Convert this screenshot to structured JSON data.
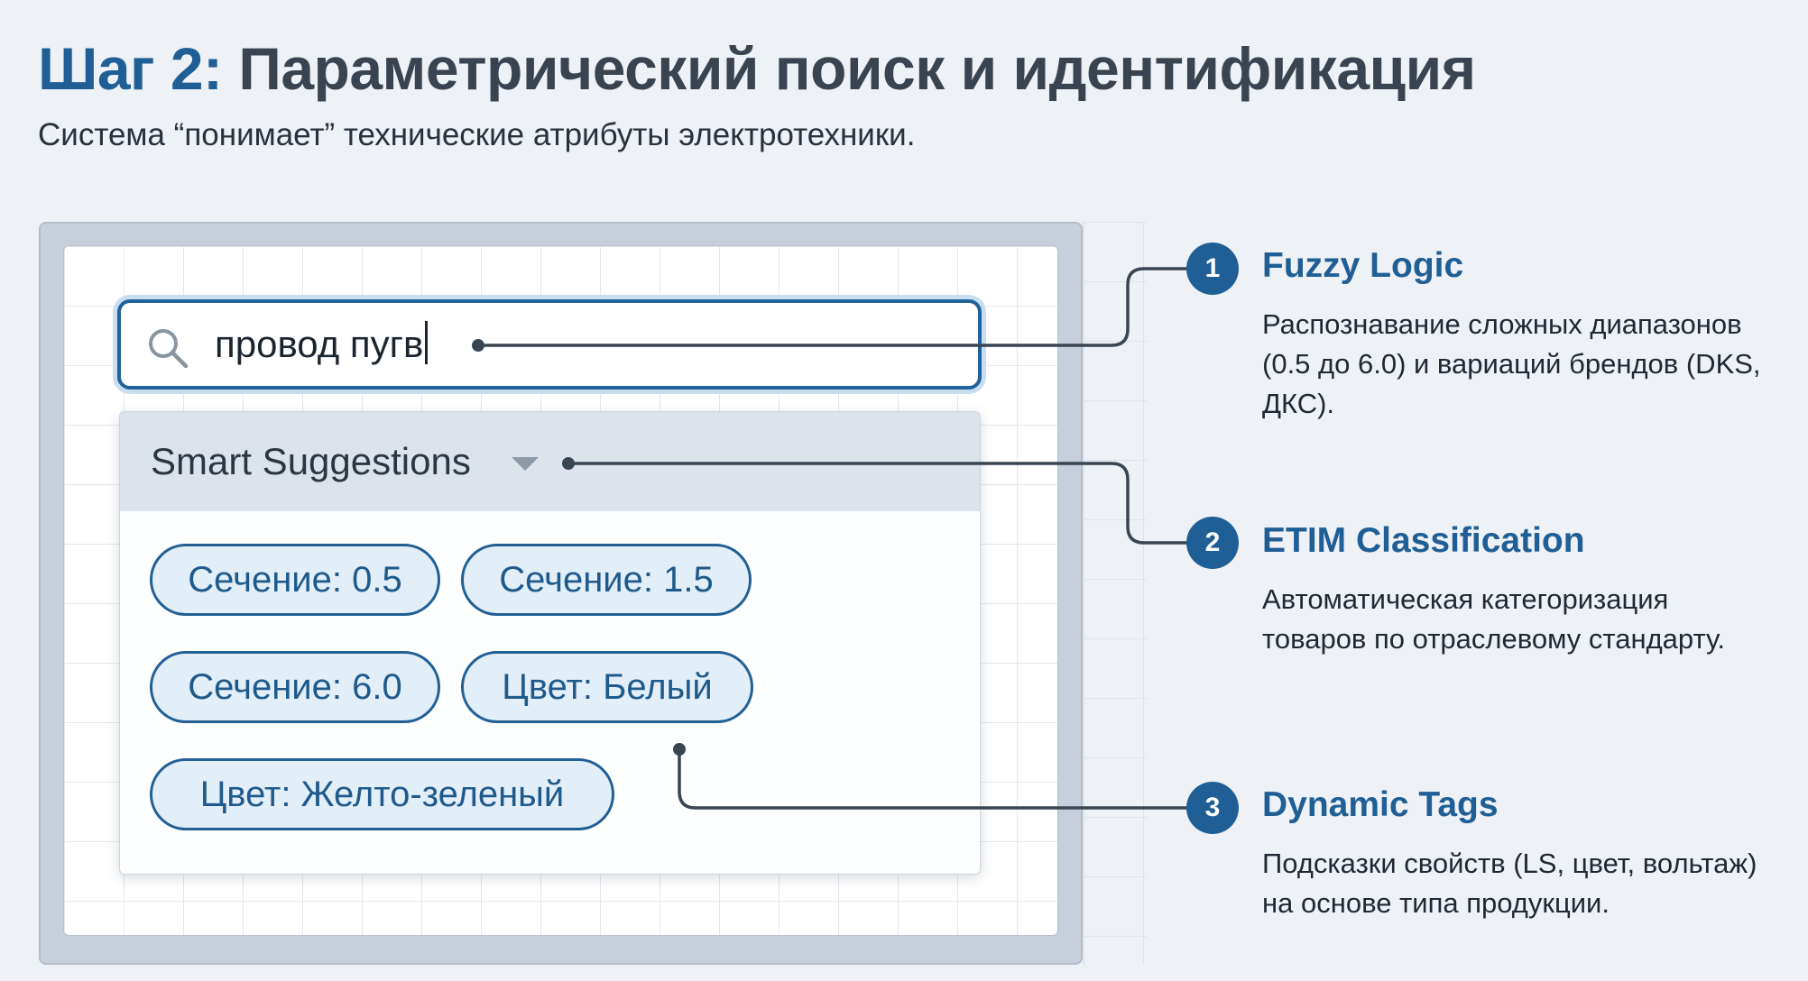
{
  "header": {
    "step_label": "Шаг 2:",
    "title": "Параметрический поиск и идентификация",
    "subtitle": "Система “понимает” технические атрибуты электротехники."
  },
  "search": {
    "icon": "search-icon",
    "value": "провод пугв"
  },
  "suggestions": {
    "title": "Smart Suggestions",
    "toggle_icon": "chevron-down-icon",
    "chips": [
      "Сечение: 0.5",
      "Сечение: 1.5",
      "Сечение: 6.0",
      "Цвет: Белый",
      "Цвет: Желто-зеленый"
    ]
  },
  "annotations": [
    {
      "number": "1",
      "title": "Fuzzy Logic",
      "description": "Распознавание сложных диапазонов (0.5 до 6.0) и вариаций брендов (DKS, ДКС)."
    },
    {
      "number": "2",
      "title": "ETIM Classification",
      "description": "Автоматическая категоризация товаров по отраслевому стандарту."
    },
    {
      "number": "3",
      "title": "Dynamic Tags",
      "description": "Подсказки свойств (LS, цвет, вольтаж) на основе типа продукции."
    }
  ],
  "colors": {
    "accent": "#1f5f96",
    "chip_fill": "#e2eef8",
    "background": "#eef1f5"
  }
}
